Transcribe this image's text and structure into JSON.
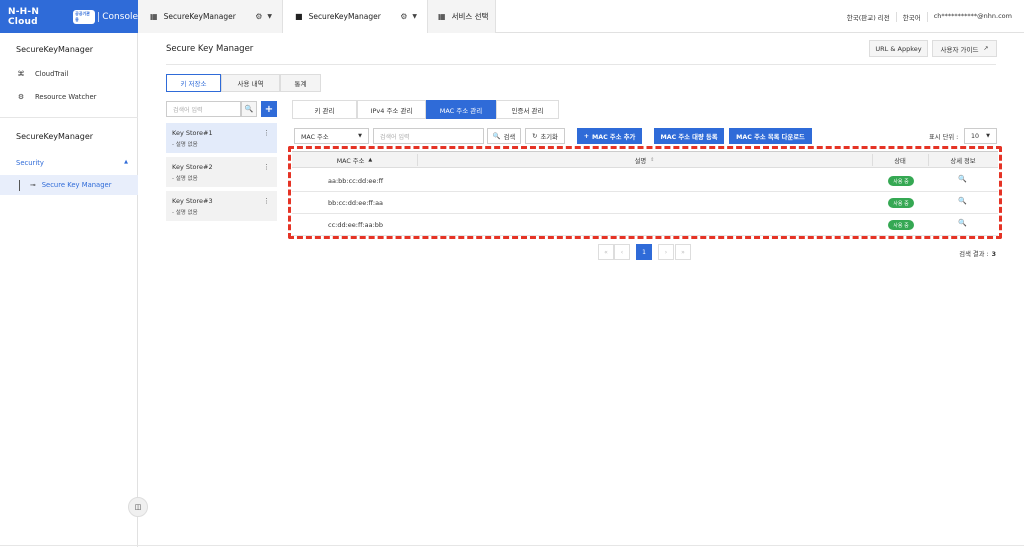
{
  "brand": {
    "logo": "N-H-N Cloud",
    "badge": "공공기관용",
    "console": "Console"
  },
  "top_tabs": [
    {
      "label": "SecureKeyManager"
    },
    {
      "label": "SecureKeyManager"
    },
    {
      "label": "서비스 선택"
    }
  ],
  "top_right": {
    "region": "한국(판교) 리전",
    "language": "한국어",
    "account": "ch***********@nhn.com"
  },
  "sidebar": {
    "section1_title": "SecureKeyManager",
    "items": [
      {
        "label": "CloudTrail",
        "icon": "cloudtrail-icon"
      },
      {
        "label": "Resource Watcher",
        "icon": "resource-watcher-icon"
      }
    ],
    "section2_title": "SecureKeyManager",
    "category": "Security",
    "active_item": "Secure Key Manager"
  },
  "main": {
    "title": "Secure Key Manager",
    "url_appkey": "URL & Appkey",
    "user_guide": "사용자 가이드",
    "tabs": [
      "키 저장소",
      "사용 내역",
      "통계"
    ],
    "keystore_search_placeholder": "검색어 입력",
    "keystores": [
      {
        "name": "Key Store#1",
        "desc": "- 설명 없음"
      },
      {
        "name": "Key Store#2",
        "desc": "- 설명 없음"
      },
      {
        "name": "Key Store#3",
        "desc": "- 설명 없음"
      }
    ],
    "sub_tabs": [
      "키 관리",
      "IPv4 주소 관리",
      "MAC 주소 관리",
      "인증서 관리"
    ],
    "filter_select": "MAC 주소",
    "filter_placeholder": "검색어 입력",
    "search_btn": "검색",
    "reset_btn": "초기화",
    "add_btn": "MAC 주소 추가",
    "bulk_btn": "MAC 주소 대량 등록",
    "download_btn": "MAC 주소 목록 다운로드",
    "page_size_label": "표시 단위 :",
    "page_size": "10",
    "table": {
      "headers": [
        "MAC 주소",
        "설명",
        "상태",
        "상세 정보"
      ],
      "rows": [
        {
          "mac": "aa:bb:cc:dd:ee:ff",
          "status": "사용 중"
        },
        {
          "mac": "bb:cc:dd:ee:ff:aa",
          "status": "사용 중"
        },
        {
          "mac": "cc:dd:ee:ff:aa:bb",
          "status": "사용 중"
        }
      ]
    },
    "pagination": {
      "current": "1"
    },
    "result_label": "검색 결과 :",
    "result_count": "3"
  },
  "colors": {
    "accent": "#2f6bd8",
    "status_green": "#35a853",
    "highlight_dash": "#e53325"
  }
}
